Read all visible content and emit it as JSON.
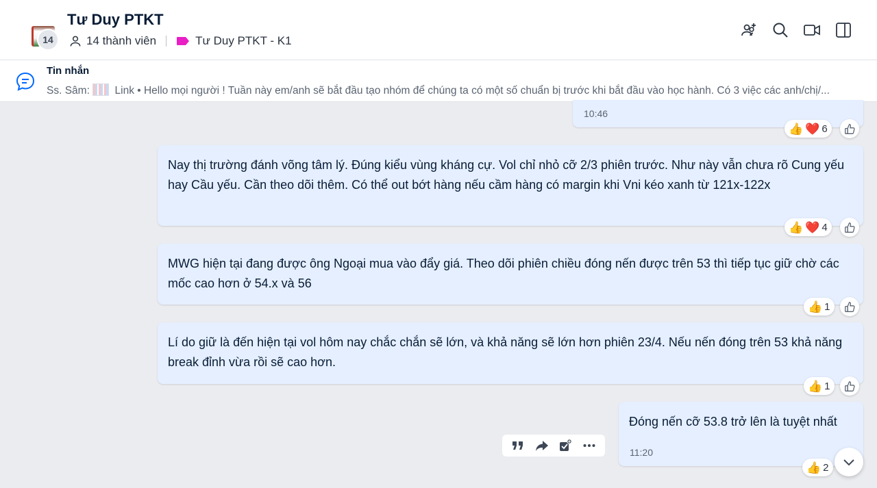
{
  "conversation": {
    "title": "Tư Duy PTKT",
    "member_badge": "14",
    "members_label": "14 thành viên",
    "tag_label": "Tư Duy PTKT - K1",
    "tag_color": "#e91ec5"
  },
  "header_actions": [
    "add-member-icon",
    "search-icon",
    "video-call-icon",
    "sidebar-toggle-icon"
  ],
  "pinned": {
    "title": "Tin nhắn",
    "sender": "Ss. Sâm:",
    "text": " Link • Hello mọi người ! Tuần này em/anh sẽ bắt đầu tạo nhóm để chúng ta có một số chuẩn bị trước khi bắt đầu vào học hành. Có 3 việc các anh/chị/..."
  },
  "messages": [
    {
      "time": "10:46",
      "reactions": {
        "like": "👍",
        "heart": "❤️",
        "count": "6"
      }
    },
    {
      "text": "Nay thị trường đánh võng tâm lý. Đúng kiểu vùng kháng cự. Vol chỉ nhỏ cỡ 2/3 phiên trước. Như này vẫn chưa rõ Cung yếu hay Cầu yếu. Cần theo dõi thêm. Có thể out bớt hàng nếu cầm hàng có margin khi Vni kéo xanh từ 121x-122x",
      "reactions": {
        "like": "👍",
        "heart": "❤️",
        "count": "4"
      }
    },
    {
      "text": "MWG hiện tại đang được ông Ngoại mua vào đẩy giá. Theo dõi phiên chiều đóng nến được trên 53 thì tiếp tục giữ chờ các mốc cao hơn ở 54.x và 56",
      "reactions": {
        "like": "👍",
        "count": "1"
      }
    },
    {
      "text": "Lí do giữ là đến hiện tại vol hôm nay chắc chắn sẽ lớn, và khả năng sẽ lớn hơn phiên 23/4. Nếu nến đóng trên 53 khả năng break đỉnh vừa rồi sẽ cao hơn.",
      "reactions": {
        "like": "👍",
        "count": "1"
      }
    },
    {
      "text": "Đóng nến cỡ 53.8 trở lên là tuyệt nhất",
      "time": "11:20",
      "reactions": {
        "like": "👍",
        "count": "2"
      }
    }
  ],
  "message_tools": [
    "quote-icon",
    "forward-icon",
    "add-task-icon",
    "more-icon"
  ],
  "colors": {
    "bubble": "#e5efff",
    "background": "#ebecf0",
    "accent": "#0068ff"
  }
}
